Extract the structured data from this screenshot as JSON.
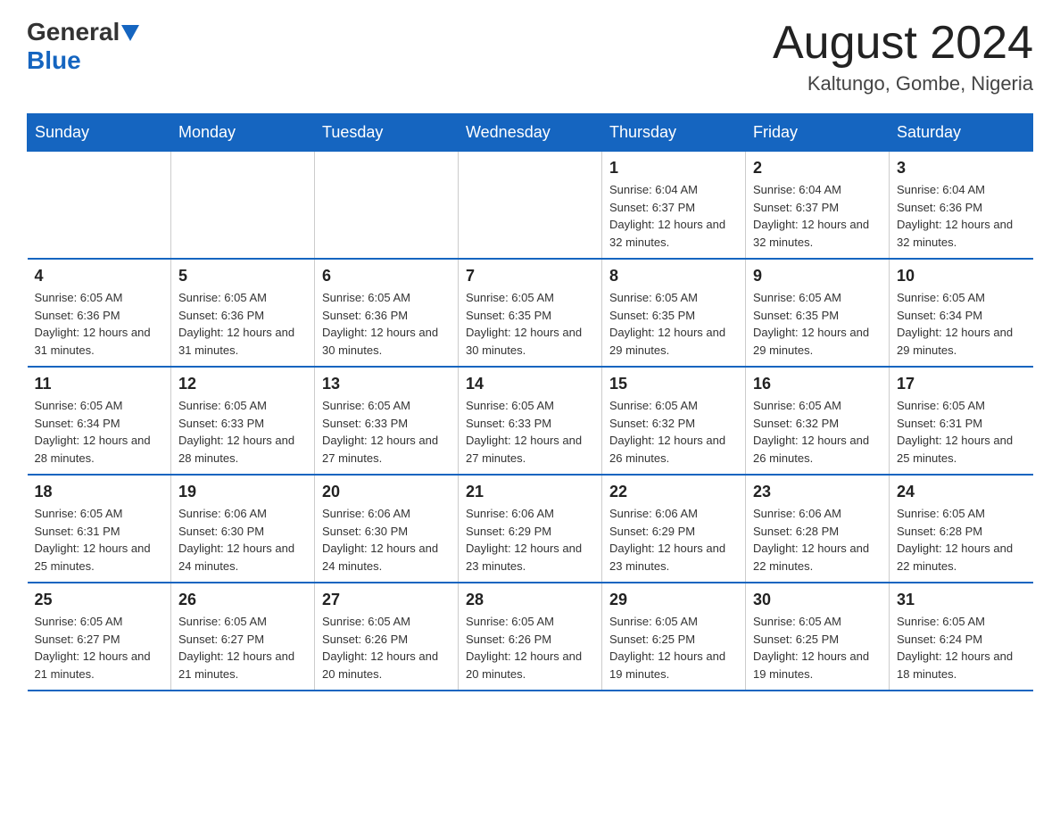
{
  "header": {
    "logo_general": "General",
    "logo_blue": "Blue",
    "month_title": "August 2024",
    "location": "Kaltungo, Gombe, Nigeria"
  },
  "weekdays": [
    "Sunday",
    "Monday",
    "Tuesday",
    "Wednesday",
    "Thursday",
    "Friday",
    "Saturday"
  ],
  "weeks": [
    [
      {
        "day": "",
        "info": ""
      },
      {
        "day": "",
        "info": ""
      },
      {
        "day": "",
        "info": ""
      },
      {
        "day": "",
        "info": ""
      },
      {
        "day": "1",
        "info": "Sunrise: 6:04 AM\nSunset: 6:37 PM\nDaylight: 12 hours and 32 minutes."
      },
      {
        "day": "2",
        "info": "Sunrise: 6:04 AM\nSunset: 6:37 PM\nDaylight: 12 hours and 32 minutes."
      },
      {
        "day": "3",
        "info": "Sunrise: 6:04 AM\nSunset: 6:36 PM\nDaylight: 12 hours and 32 minutes."
      }
    ],
    [
      {
        "day": "4",
        "info": "Sunrise: 6:05 AM\nSunset: 6:36 PM\nDaylight: 12 hours and 31 minutes."
      },
      {
        "day": "5",
        "info": "Sunrise: 6:05 AM\nSunset: 6:36 PM\nDaylight: 12 hours and 31 minutes."
      },
      {
        "day": "6",
        "info": "Sunrise: 6:05 AM\nSunset: 6:36 PM\nDaylight: 12 hours and 30 minutes."
      },
      {
        "day": "7",
        "info": "Sunrise: 6:05 AM\nSunset: 6:35 PM\nDaylight: 12 hours and 30 minutes."
      },
      {
        "day": "8",
        "info": "Sunrise: 6:05 AM\nSunset: 6:35 PM\nDaylight: 12 hours and 29 minutes."
      },
      {
        "day": "9",
        "info": "Sunrise: 6:05 AM\nSunset: 6:35 PM\nDaylight: 12 hours and 29 minutes."
      },
      {
        "day": "10",
        "info": "Sunrise: 6:05 AM\nSunset: 6:34 PM\nDaylight: 12 hours and 29 minutes."
      }
    ],
    [
      {
        "day": "11",
        "info": "Sunrise: 6:05 AM\nSunset: 6:34 PM\nDaylight: 12 hours and 28 minutes."
      },
      {
        "day": "12",
        "info": "Sunrise: 6:05 AM\nSunset: 6:33 PM\nDaylight: 12 hours and 28 minutes."
      },
      {
        "day": "13",
        "info": "Sunrise: 6:05 AM\nSunset: 6:33 PM\nDaylight: 12 hours and 27 minutes."
      },
      {
        "day": "14",
        "info": "Sunrise: 6:05 AM\nSunset: 6:33 PM\nDaylight: 12 hours and 27 minutes."
      },
      {
        "day": "15",
        "info": "Sunrise: 6:05 AM\nSunset: 6:32 PM\nDaylight: 12 hours and 26 minutes."
      },
      {
        "day": "16",
        "info": "Sunrise: 6:05 AM\nSunset: 6:32 PM\nDaylight: 12 hours and 26 minutes."
      },
      {
        "day": "17",
        "info": "Sunrise: 6:05 AM\nSunset: 6:31 PM\nDaylight: 12 hours and 25 minutes."
      }
    ],
    [
      {
        "day": "18",
        "info": "Sunrise: 6:05 AM\nSunset: 6:31 PM\nDaylight: 12 hours and 25 minutes."
      },
      {
        "day": "19",
        "info": "Sunrise: 6:06 AM\nSunset: 6:30 PM\nDaylight: 12 hours and 24 minutes."
      },
      {
        "day": "20",
        "info": "Sunrise: 6:06 AM\nSunset: 6:30 PM\nDaylight: 12 hours and 24 minutes."
      },
      {
        "day": "21",
        "info": "Sunrise: 6:06 AM\nSunset: 6:29 PM\nDaylight: 12 hours and 23 minutes."
      },
      {
        "day": "22",
        "info": "Sunrise: 6:06 AM\nSunset: 6:29 PM\nDaylight: 12 hours and 23 minutes."
      },
      {
        "day": "23",
        "info": "Sunrise: 6:06 AM\nSunset: 6:28 PM\nDaylight: 12 hours and 22 minutes."
      },
      {
        "day": "24",
        "info": "Sunrise: 6:05 AM\nSunset: 6:28 PM\nDaylight: 12 hours and 22 minutes."
      }
    ],
    [
      {
        "day": "25",
        "info": "Sunrise: 6:05 AM\nSunset: 6:27 PM\nDaylight: 12 hours and 21 minutes."
      },
      {
        "day": "26",
        "info": "Sunrise: 6:05 AM\nSunset: 6:27 PM\nDaylight: 12 hours and 21 minutes."
      },
      {
        "day": "27",
        "info": "Sunrise: 6:05 AM\nSunset: 6:26 PM\nDaylight: 12 hours and 20 minutes."
      },
      {
        "day": "28",
        "info": "Sunrise: 6:05 AM\nSunset: 6:26 PM\nDaylight: 12 hours and 20 minutes."
      },
      {
        "day": "29",
        "info": "Sunrise: 6:05 AM\nSunset: 6:25 PM\nDaylight: 12 hours and 19 minutes."
      },
      {
        "day": "30",
        "info": "Sunrise: 6:05 AM\nSunset: 6:25 PM\nDaylight: 12 hours and 19 minutes."
      },
      {
        "day": "31",
        "info": "Sunrise: 6:05 AM\nSunset: 6:24 PM\nDaylight: 12 hours and 18 minutes."
      }
    ]
  ]
}
